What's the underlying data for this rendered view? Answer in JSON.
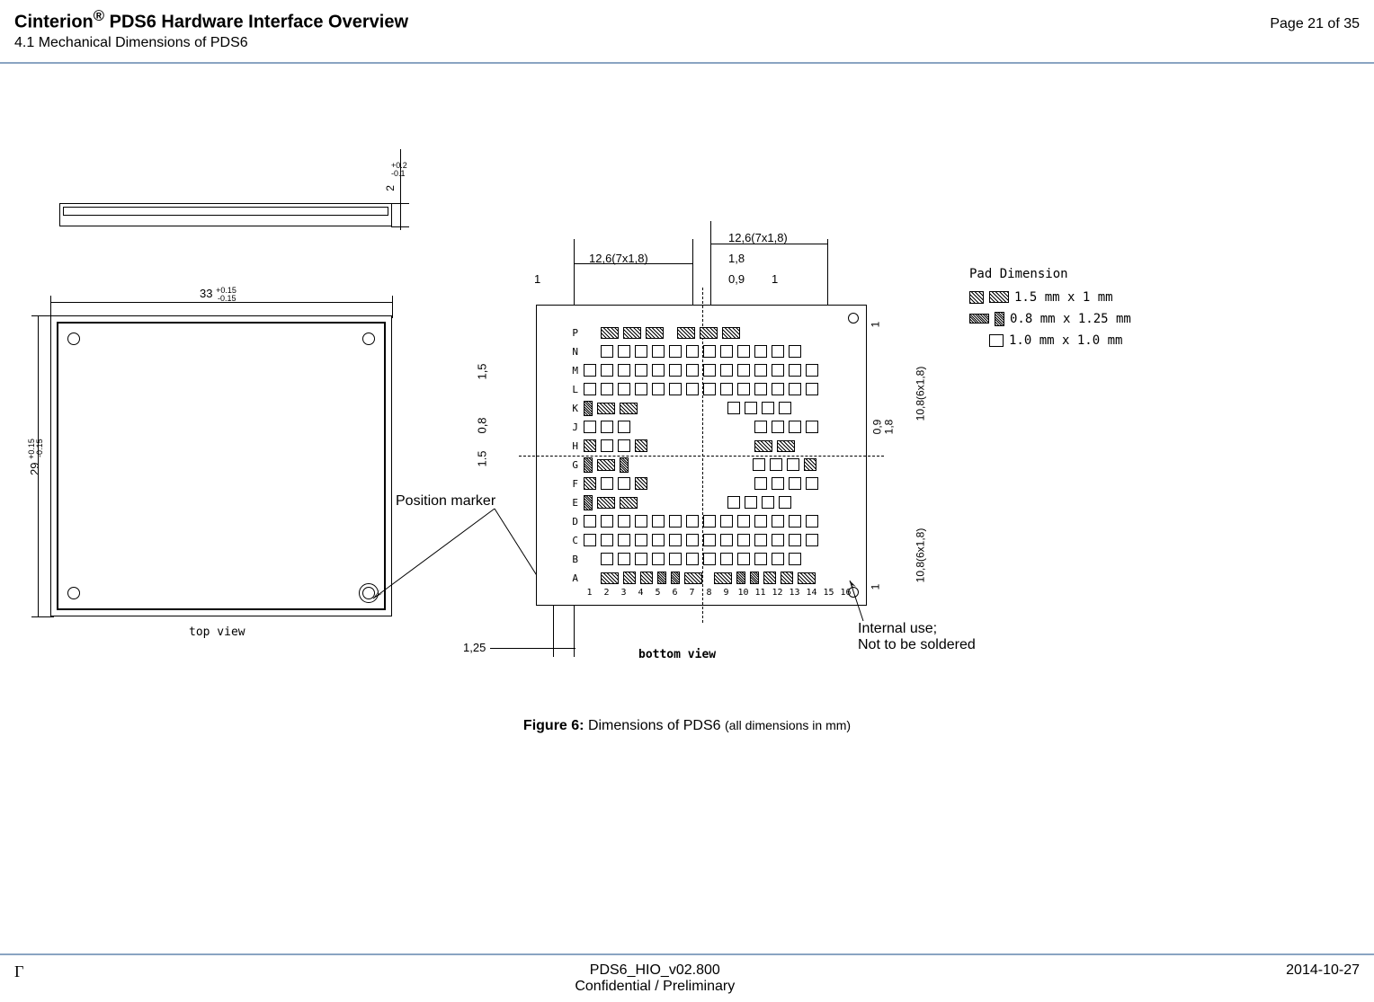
{
  "header": {
    "title_prefix": "Cinterion",
    "title_reg": "®",
    "title_suffix": " PDS6 Hardware Interface Overview",
    "page_info": "Page 21 of 35",
    "subtitle": "4.1 Mechanical Dimensions of PDS6"
  },
  "top_view": {
    "width_dim": "33",
    "width_tol_upper": "+0.15",
    "width_tol_lower": "-0.15",
    "height_dim": "29",
    "height_tol_upper": "+0.15",
    "height_tol_lower": "-0.15",
    "thickness_dim": "2",
    "thickness_tol_upper": "+0.2",
    "thickness_tol_lower": "-0.1",
    "label": "top view"
  },
  "bottom_view": {
    "label": "bottom view",
    "dim_126_top1": "12,6(7x1,8)",
    "dim_126_top2": "12,6(7x1,8)",
    "dim_18_top": "1,8",
    "dim_09_top": "0,9",
    "dim_1_top_left": "1",
    "dim_1_top_right": "1",
    "dim_15_left1": "1,5",
    "dim_08_left": "0,8",
    "dim_15_left2": "1.5",
    "dim_125_bottom": "1,25",
    "dim_108_right1": "10,8(6x1,8)",
    "dim_108_right2": "10,8(6x1,8)",
    "dim_09_right": "0,9",
    "dim_18_right": "1,8",
    "dim_1_right1": "1",
    "dim_1_right2": "1",
    "row_labels": [
      "P",
      "N",
      "M",
      "L",
      "K",
      "J",
      "H",
      "G",
      "F",
      "E",
      "D",
      "C",
      "B",
      "A"
    ],
    "col_labels": [
      "1",
      "2",
      "3",
      "4",
      "5",
      "6",
      "7",
      "8",
      "9",
      "10",
      "11",
      "12",
      "13",
      "14",
      "15",
      "16"
    ]
  },
  "annotations": {
    "position_marker": "Position marker",
    "internal_use_line1": "Internal use;",
    "internal_use_line2": "Not to be soldered"
  },
  "legend": {
    "title": "Pad Dimension",
    "row1": "1.5 mm x 1 mm",
    "row2": "0.8 mm x 1.25 mm",
    "row3": "1.0 mm x 1.0 mm"
  },
  "figure": {
    "label": "Figure 6:",
    "text": "Dimensions of PDS6",
    "note": "(all dimensions in mm)"
  },
  "footer": {
    "left": "Γ",
    "center_line1": "PDS6_HIO_v02.800",
    "center_line2": "Confidential / Preliminary",
    "right": "2014-10-27"
  }
}
